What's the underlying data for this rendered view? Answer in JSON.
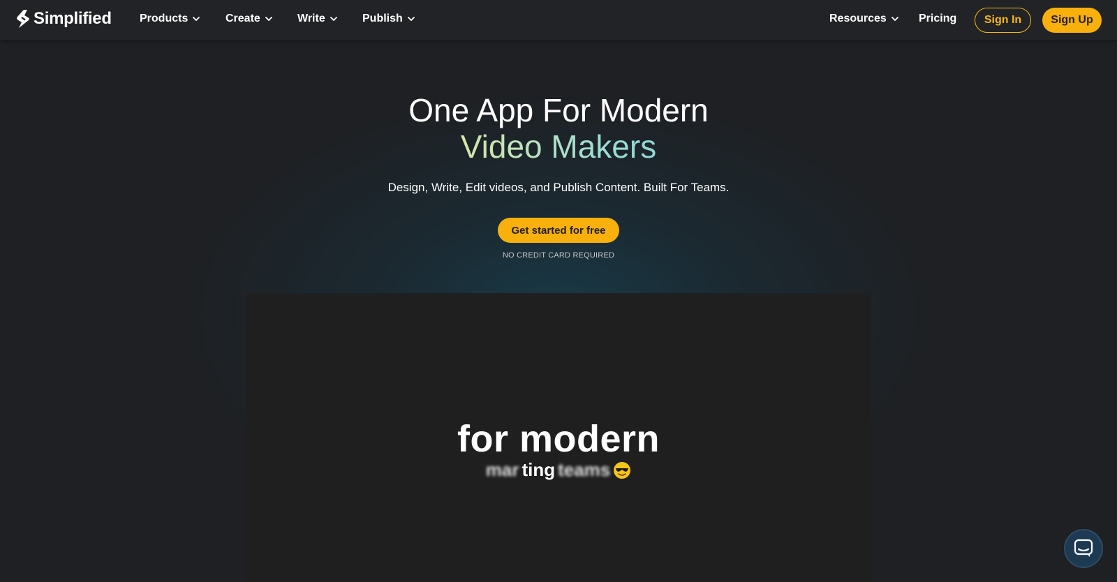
{
  "brand": {
    "name": "Simplified"
  },
  "nav": {
    "items": [
      {
        "label": "Products",
        "icon": "chevron-down-icon"
      },
      {
        "label": "Create",
        "icon": "chevron-down-icon"
      },
      {
        "label": "Write",
        "icon": "chevron-down-icon"
      },
      {
        "label": "Publish",
        "icon": "chevron-down-icon"
      },
      {
        "label": "Resources",
        "icon": "chevron-down-icon"
      },
      {
        "label": "Pricing"
      }
    ],
    "sign_in": "Sign In",
    "sign_up": "Sign Up"
  },
  "hero": {
    "title_line1": "One App For Modern",
    "title_line2": "Video Makers",
    "subtitle": "Design, Write, Edit videos, and Publish Content. Built For Teams.",
    "cta": "Get started for free",
    "note": "NO CREDIT CARD REQUIRED"
  },
  "video": {
    "line1": "for modern",
    "line2_blur": "marketing",
    "line2_text": "ting",
    "line2_end": "teams",
    "emoji": "sunglasses-emoji-icon"
  },
  "colors": {
    "accent": "#f8b00c",
    "background": "#1e2023",
    "nav_background": "#222326"
  },
  "chat": {
    "icon": "chat-bubble-icon"
  }
}
